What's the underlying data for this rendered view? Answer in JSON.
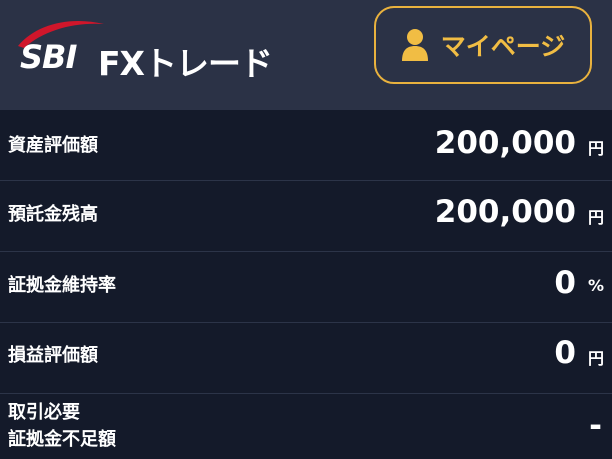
{
  "header": {
    "logo_sbi": "SBI",
    "logo_fx": "FXトレード",
    "mypage_label": "マイページ",
    "accent_color": "#e9b23e",
    "icons": [
      "person-icon"
    ]
  },
  "rows": [
    {
      "label": "資産評価額",
      "value": "200,000",
      "unit": "円"
    },
    {
      "label": "預託金残高",
      "value": "200,000",
      "unit": "円"
    },
    {
      "label": "証拠金維持率",
      "value": "0",
      "unit": "%"
    },
    {
      "label": "損益評価額",
      "value": "0",
      "unit": "円"
    },
    {
      "label_line1": "取引必要",
      "label_line2": "証拠金不足額",
      "value": "-",
      "unit": ""
    }
  ]
}
